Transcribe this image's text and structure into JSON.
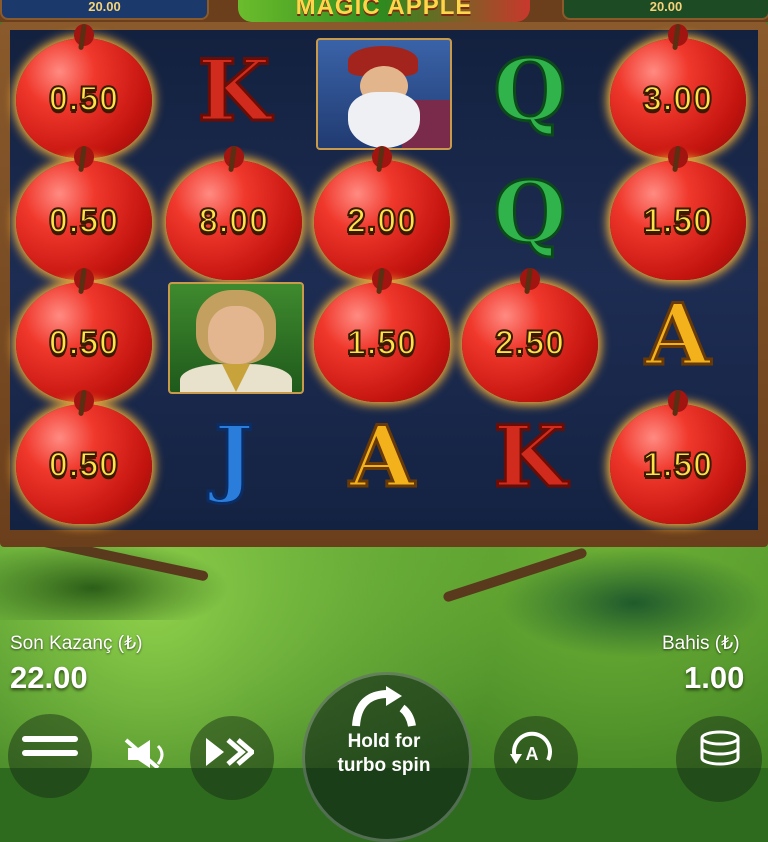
{
  "header": {
    "left_box_text": "20.00",
    "right_box_text": "20.00",
    "logo_text": "MAGIC APPLE"
  },
  "reels": {
    "grid": [
      [
        {
          "type": "apple",
          "value": "0.50"
        },
        {
          "type": "apple",
          "value": "0.50"
        },
        {
          "type": "apple",
          "value": "0.50"
        },
        {
          "type": "apple",
          "value": "0.50"
        }
      ],
      [
        {
          "type": "letter",
          "value": "K",
          "color": "#d02b1c"
        },
        {
          "type": "apple",
          "value": "8.00"
        },
        {
          "type": "portrait",
          "value": "prince"
        },
        {
          "type": "letter",
          "value": "J",
          "color": "#2b7ddc"
        }
      ],
      [
        {
          "type": "portrait",
          "value": "dwarf"
        },
        {
          "type": "apple",
          "value": "2.00"
        },
        {
          "type": "apple",
          "value": "1.50"
        },
        {
          "type": "letter",
          "value": "A",
          "color": "#f3b21c"
        }
      ],
      [
        {
          "type": "letter",
          "value": "Q",
          "color": "#2fb34a"
        },
        {
          "type": "letter",
          "value": "Q",
          "color": "#2fb34a"
        },
        {
          "type": "apple",
          "value": "2.50"
        },
        {
          "type": "letter",
          "value": "K",
          "color": "#d02b1c"
        }
      ],
      [
        {
          "type": "apple",
          "value": "3.00"
        },
        {
          "type": "apple",
          "value": "1.50"
        },
        {
          "type": "letter",
          "value": "A",
          "color": "#f3b21c"
        },
        {
          "type": "apple",
          "value": "1.50"
        }
      ]
    ]
  },
  "hud": {
    "last_win_label": "Son Kazanç (₺)",
    "last_win_value": "22.00",
    "bet_label": "Bahis (₺)",
    "bet_value": "1.00",
    "spin_label_line1": "Hold for",
    "spin_label_line2": "turbo spin"
  },
  "icons": {
    "menu": "menu-icon",
    "sound": "sound-muted-icon",
    "turbo": "fast-forward-icon",
    "spin": "spin-arrows-icon",
    "autoplay": "autoplay-icon",
    "bet": "coin-stack-icon"
  }
}
